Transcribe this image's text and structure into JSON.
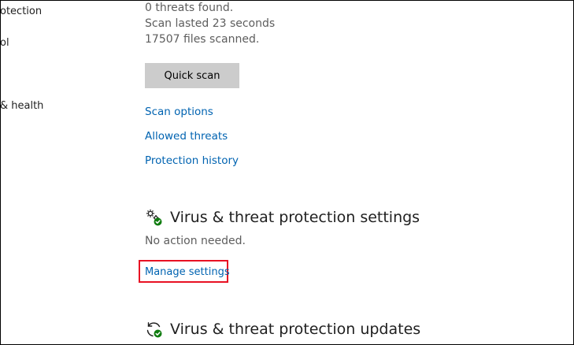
{
  "sidebar": {
    "items": [
      {
        "label": "otection"
      },
      {
        "label": "ol"
      },
      {
        "label": "& health"
      }
    ]
  },
  "scan_status": {
    "threats": "0 threats found.",
    "duration": "Scan lasted 23 seconds",
    "files": "17507 files scanned."
  },
  "buttons": {
    "quick_scan": "Quick scan"
  },
  "links": {
    "scan_options": "Scan options",
    "allowed_threats": "Allowed threats",
    "protection_history": "Protection history"
  },
  "settings_section": {
    "title": "Virus & threat protection settings",
    "status": "No action needed.",
    "manage_link": "Manage settings",
    "icon": "gears-check-icon"
  },
  "updates_section": {
    "title": "Virus & threat protection updates",
    "icon": "refresh-check-icon"
  },
  "colors": {
    "link": "#0063b1",
    "highlight": "#e81123",
    "status_ok": "#107c10",
    "button_bg": "#cccccc"
  }
}
